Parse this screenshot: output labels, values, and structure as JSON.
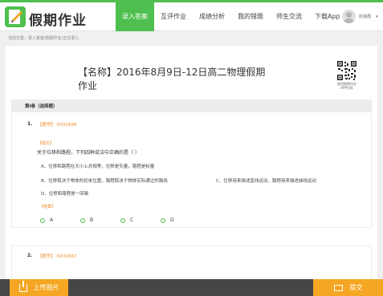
{
  "header": {
    "brand": "假期作业",
    "nav": [
      {
        "label": "录入答案",
        "active": true
      },
      {
        "label": "互评作业",
        "active": false
      },
      {
        "label": "成绩分析",
        "active": false
      },
      {
        "label": "我的错题",
        "active": false
      },
      {
        "label": "师生交流",
        "active": false
      },
      {
        "label": "下载App",
        "active": false
      }
    ],
    "username": "赵钱霞"
  },
  "breadcrumb": "当前位置：录入答案/假期作业/正在录入",
  "page": {
    "title": "【名称】2016年8月9日-12日高二物理假期作业",
    "qr_caption_line1": "使用假期作业",
    "qr_caption_line2": "APP扫码"
  },
  "section": {
    "label": "第I卷（选择题）"
  },
  "questions": [
    {
      "number": "1.",
      "id_text": "【题号】-5031666",
      "stem_tag": "【题文】",
      "stem": "关于位移和路程，下列四种说法中正确的是（   ）",
      "options": [
        "A、位移和路程在大小上总相等，位移是矢量，路程是标量",
        "B、位移取决于物体的初末位置，路程取决于物体实际通过的路线",
        "C、位移用来描述直线运动，路程用来描述曲线运动",
        "D、位移和路程是一回事"
      ],
      "answer_tag": "【答案】",
      "choices": [
        "A",
        "B",
        "C",
        "D"
      ]
    },
    {
      "number": "2.",
      "id_text": "【题号】-5031667"
    }
  ],
  "footer": {
    "upload_label": "上传图片",
    "submit_label": "提交"
  },
  "colors": {
    "accent": "#4fc04f",
    "orange": "#f5a623",
    "tag": "#f08a24"
  }
}
